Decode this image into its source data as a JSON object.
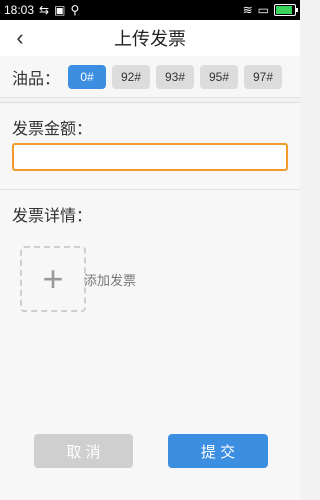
{
  "status": {
    "time": "18:03",
    "icons": [
      "usb-icon",
      "image-icon",
      "share-icon",
      "wifi-icon",
      "sim-icon",
      "battery-icon"
    ]
  },
  "header": {
    "title": "上传发票"
  },
  "oil": {
    "label": "油品：",
    "grades": [
      {
        "label": "0#",
        "selected": true
      },
      {
        "label": "92#",
        "selected": false
      },
      {
        "label": "93#",
        "selected": false
      },
      {
        "label": "95#",
        "selected": false
      },
      {
        "label": "97#",
        "selected": false
      }
    ]
  },
  "amount": {
    "label": "发票金额：",
    "value": "",
    "placeholder": ""
  },
  "details": {
    "label": "发票详情：",
    "add_text": "添加发票"
  },
  "buttons": {
    "cancel": "取 消",
    "submit": "提 交"
  },
  "colors": {
    "primary": "#3c8fe0",
    "accent_border": "#f39a2d",
    "cancel_bg": "#cfcfcf"
  }
}
